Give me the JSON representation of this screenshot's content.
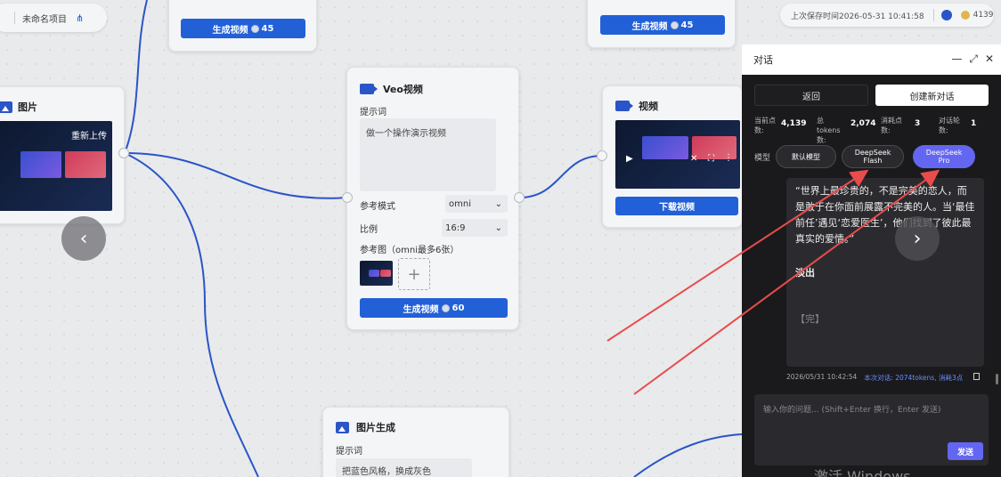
{
  "project": {
    "name": "未命名项目"
  },
  "topbar": {
    "saved_time": "上次保存时间2026-05-31 10:41:58",
    "credits": "4139"
  },
  "nodes": {
    "top_left": {
      "generate_label": "生成视频",
      "cost": "45"
    },
    "top_right": {
      "generate_label": "生成视频",
      "cost": "45"
    },
    "image_node": {
      "title": "图片",
      "reupload": "重新上传"
    },
    "veo": {
      "title": "Veo视频",
      "prompt_label": "提示词",
      "prompt_value": "做一个操作演示视频",
      "mode_label": "参考模式",
      "mode_value": "omni",
      "ratio_label": "比例",
      "ratio_value": "16:9",
      "ref_label": "参考图（omni最多6张）",
      "generate_label": "生成视频",
      "cost": "60"
    },
    "video_node": {
      "title": "视频",
      "download": "下载视频"
    },
    "image_gen": {
      "title": "图片生成",
      "prompt_label": "提示词",
      "prompt_value": "把蓝色风格，换成灰色"
    }
  },
  "chat": {
    "title": "对话",
    "back": "返回",
    "new_chat": "创建新对话",
    "stats": [
      {
        "label": "当前点数:",
        "value": "4,139"
      },
      {
        "label": "总tokens数:",
        "value": "2,074"
      },
      {
        "label": "消耗点数:",
        "value": "3"
      },
      {
        "label": "对话轮数:",
        "value": "1"
      }
    ],
    "model_label": "模型",
    "models": [
      {
        "label": "默认模型",
        "active": false
      },
      {
        "label": "DeepSeek Flash",
        "active": false
      },
      {
        "label": "DeepSeek Pro",
        "active": true
      }
    ],
    "message_lines": "“世界上最珍贵的，不是完美的恋人，而是敢于在你面前展露不完美的人。当‘最佳前任’遇见‘恋爱医生’，他们找到了彼此最真实的爱情。”",
    "message_fade": "淡出",
    "message_end": "【完】",
    "meta_time": "2026/05/31 10:42:54",
    "meta_usage": "本次对话: 2074tokens, 消耗3点",
    "input_placeholder": "输入你的问题... (Shift+Enter 换行，Enter 发送)",
    "send": "发送"
  },
  "watermark": "激活 Windows",
  "colors": {
    "accent": "#2260d8",
    "chat_accent": "#6366f1",
    "arrow": "#e84c4c"
  }
}
